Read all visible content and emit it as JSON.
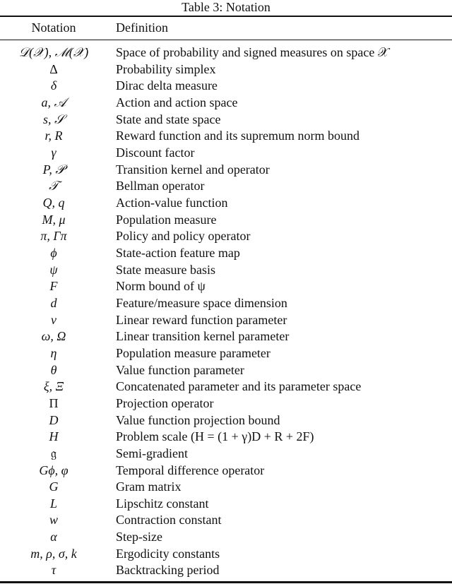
{
  "caption": "Table 3: Notation",
  "columns": {
    "notation": "Notation",
    "definition": "Definition"
  },
  "rows": [
    {
      "notation": "𝒟(𝒳), ℳ(𝒳)",
      "definition": "Space of probability and signed measures on space 𝒳"
    },
    {
      "notation": "Δ",
      "definition": "Probability simplex"
    },
    {
      "notation": "δ",
      "definition": "Dirac delta measure"
    },
    {
      "notation": "a, 𝒜",
      "definition": "Action and action space"
    },
    {
      "notation": "s, 𝒮",
      "definition": "State and state space"
    },
    {
      "notation": "r, R",
      "definition": "Reward function and its supremum norm bound"
    },
    {
      "notation": "γ",
      "definition": "Discount factor"
    },
    {
      "notation": "P, 𝒫",
      "definition": "Transition kernel and operator"
    },
    {
      "notation": "𝒯",
      "definition": "Bellman operator"
    },
    {
      "notation": "Q, q",
      "definition": "Action-value function"
    },
    {
      "notation": "M, μ",
      "definition": "Population measure"
    },
    {
      "notation": "π, Γπ",
      "definition": "Policy and policy operator"
    },
    {
      "notation": "ϕ",
      "definition": "State-action feature map"
    },
    {
      "notation": "ψ",
      "definition": "State measure basis"
    },
    {
      "notation": "F",
      "definition": "Norm bound of ψ"
    },
    {
      "notation": "d",
      "definition": "Feature/measure space dimension"
    },
    {
      "notation": "ν",
      "definition": "Linear reward function parameter"
    },
    {
      "notation": "ω, Ω",
      "definition": "Linear transition kernel parameter"
    },
    {
      "notation": "η",
      "definition": "Population measure parameter"
    },
    {
      "notation": "θ",
      "definition": "Value function parameter"
    },
    {
      "notation": "ξ, Ξ",
      "definition": "Concatenated parameter and its parameter space"
    },
    {
      "notation": "Π",
      "definition": "Projection operator"
    },
    {
      "notation": "D",
      "definition": "Value function projection bound"
    },
    {
      "notation": "H",
      "definition": "Problem scale (H = (1 + γ)D + R + 2F)"
    },
    {
      "notation": "𝔤",
      "definition": "Semi-gradient"
    },
    {
      "notation": "Gϕ, φ",
      "definition": "Temporal difference operator"
    },
    {
      "notation": "G",
      "definition": "Gram matrix"
    },
    {
      "notation": "L",
      "definition": "Lipschitz constant"
    },
    {
      "notation": "w",
      "definition": "Contraction constant"
    },
    {
      "notation": "α",
      "definition": "Step-size"
    },
    {
      "notation": "m, ρ, σ, k",
      "definition": "Ergodicity constants"
    },
    {
      "notation": "τ",
      "definition": "Backtracking period"
    }
  ]
}
